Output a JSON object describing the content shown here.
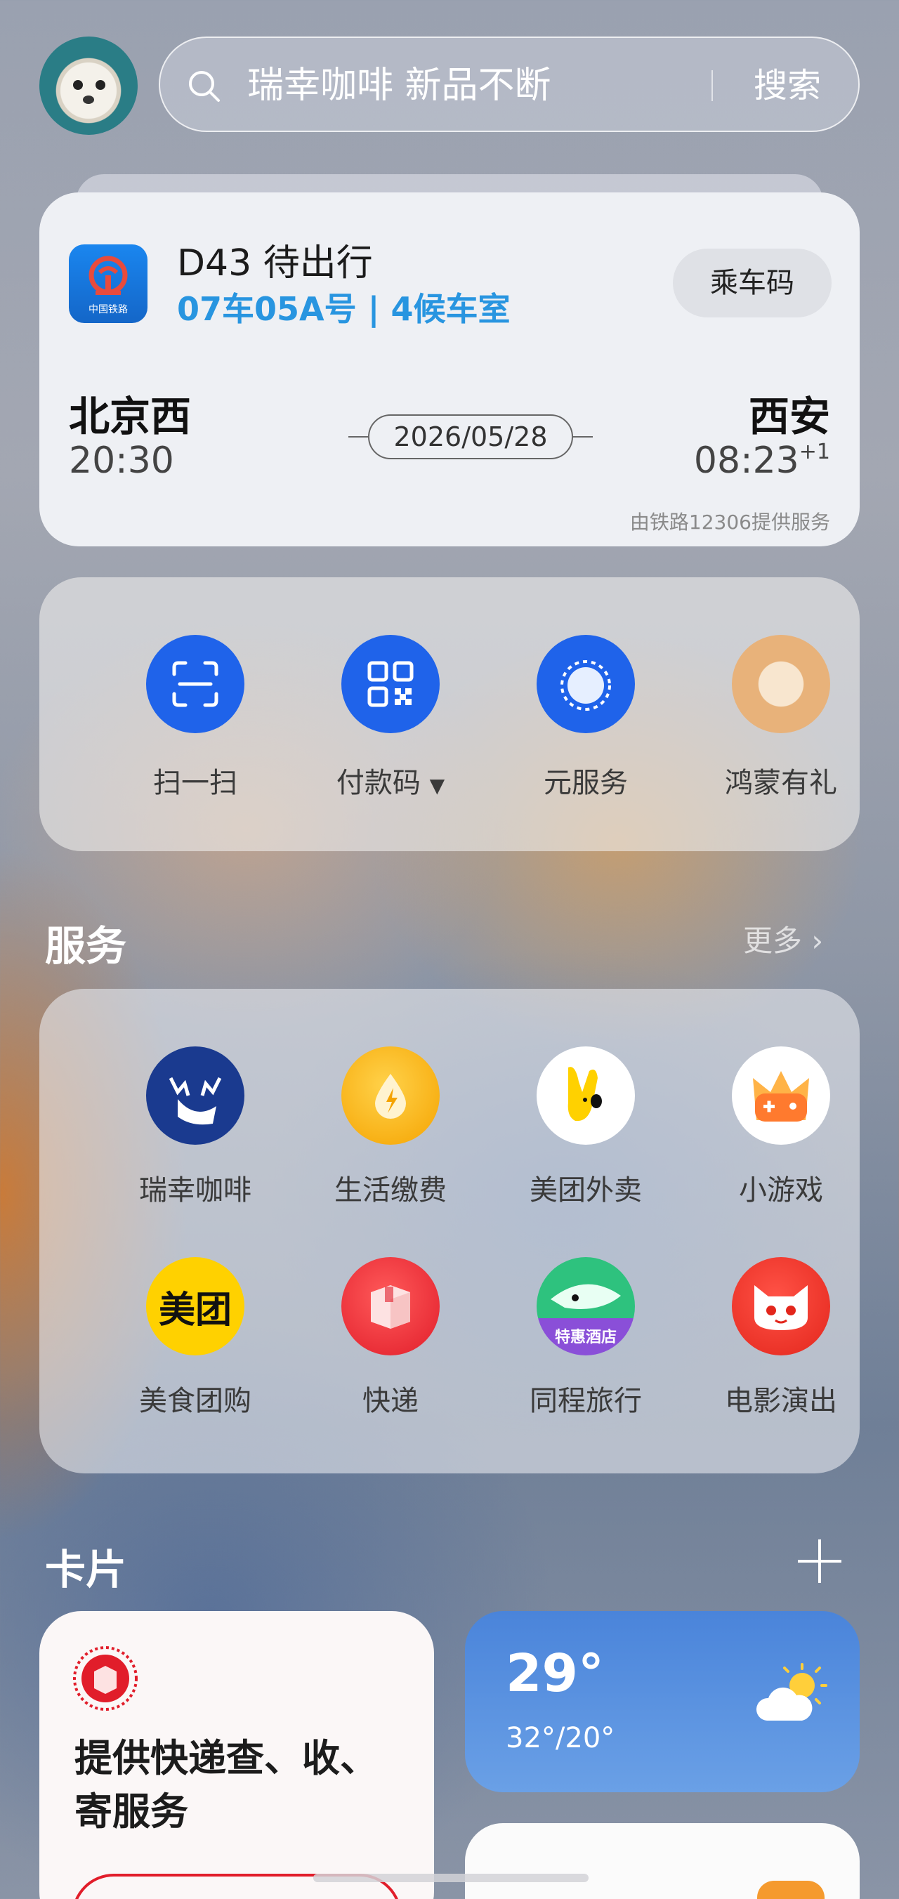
{
  "search": {
    "placeholder": "瑞幸咖啡 新品不断",
    "button": "搜索"
  },
  "trip": {
    "title": "D43 待出行",
    "seat": "07车05A号 | 4候车室",
    "ticket_button": "乘车码",
    "logo_caption": "中国铁路",
    "from_city": "北京西",
    "from_time": "20:30",
    "to_city": "西安",
    "to_time": "08:23",
    "day_offset": "+1",
    "date": "2026/05/28",
    "provider": "由铁路12306提供服务"
  },
  "quick_actions": [
    {
      "label": "扫一扫",
      "icon": "scan-icon"
    },
    {
      "label": "付款码",
      "icon": "qr-code-icon"
    },
    {
      "label": "元服务",
      "icon": "meta-service-icon"
    },
    {
      "label": "鸿蒙有礼",
      "icon": "harmony-gift-icon"
    }
  ],
  "services": {
    "title": "服务",
    "more": "更多",
    "items": [
      {
        "label": "瑞幸咖啡",
        "icon": "luckin-coffee-icon"
      },
      {
        "label": "生活缴费",
        "icon": "utility-bill-icon"
      },
      {
        "label": "美团外卖",
        "icon": "meituan-waimai-icon"
      },
      {
        "label": "小游戏",
        "icon": "mini-game-icon"
      },
      {
        "label": "美食团购",
        "icon": "meituan-icon"
      },
      {
        "label": "快递",
        "icon": "parcel-icon"
      },
      {
        "label": "同程旅行",
        "icon": "tongcheng-icon"
      },
      {
        "label": "电影演出",
        "icon": "maoyan-cat-icon"
      }
    ],
    "meituan_logo_text": "美团",
    "tongcheng_badge": "特惠酒店"
  },
  "cards": {
    "title": "卡片",
    "delivery_text": "提供快递查、收、寄服务",
    "weather": {
      "temp": "29°",
      "range": "32°/20°"
    }
  },
  "colors": {
    "accent_blue": "#1f63ea",
    "seat_blue": "#2895e0",
    "weather_blue": "#4a84da"
  }
}
